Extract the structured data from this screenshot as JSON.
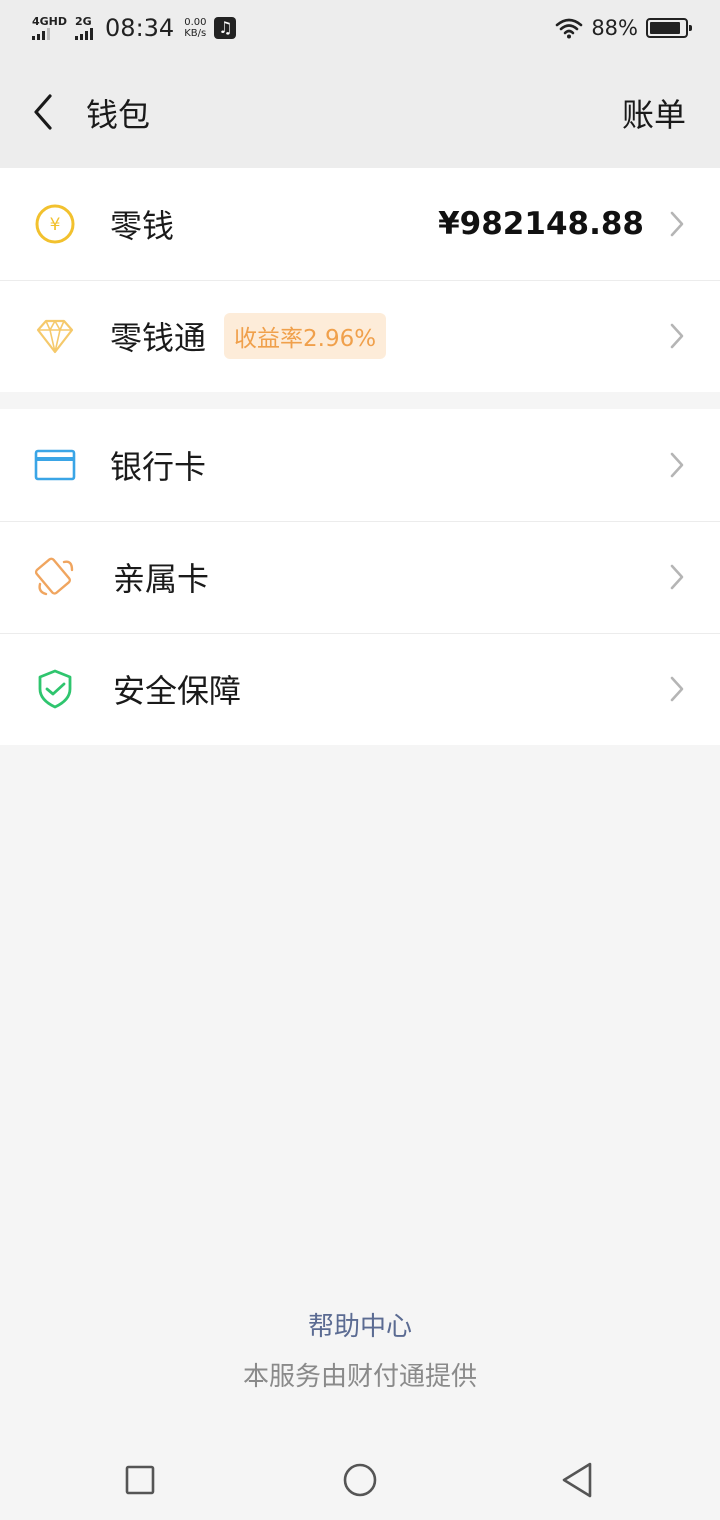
{
  "status": {
    "net1": "4GHD",
    "net2": "2G",
    "time": "08:34",
    "speed_value": "0.00",
    "speed_unit": "KB/s",
    "battery": "88%"
  },
  "header": {
    "title": "钱包",
    "right_action": "账单"
  },
  "groups": {
    "main": {
      "change": {
        "label": "零钱",
        "amount": "¥982148.88",
        "icon": "yuan-coin-icon"
      },
      "lingqiantong": {
        "label": "零钱通",
        "badge": "收益率2.96%",
        "icon": "diamond-icon"
      }
    },
    "cards": {
      "bank_card": {
        "label": "银行卡",
        "icon": "bank-card-icon"
      },
      "family_card": {
        "label": "亲属卡",
        "icon": "family-card-icon"
      },
      "security": {
        "label": "安全保障",
        "icon": "shield-check-icon"
      }
    }
  },
  "footer": {
    "help": "帮助中心",
    "provider": "本服务由财付通提供"
  },
  "colors": {
    "accent_yellow": "#f2c12e",
    "diamond_yellow": "#f5c96b",
    "card_blue": "#3aa5e6",
    "family_orange": "#f0a55f",
    "shield_green": "#2fc56e",
    "badge_bg": "#fdecd9",
    "badge_text": "#f0a04b",
    "link_blue": "#5b6b92"
  }
}
